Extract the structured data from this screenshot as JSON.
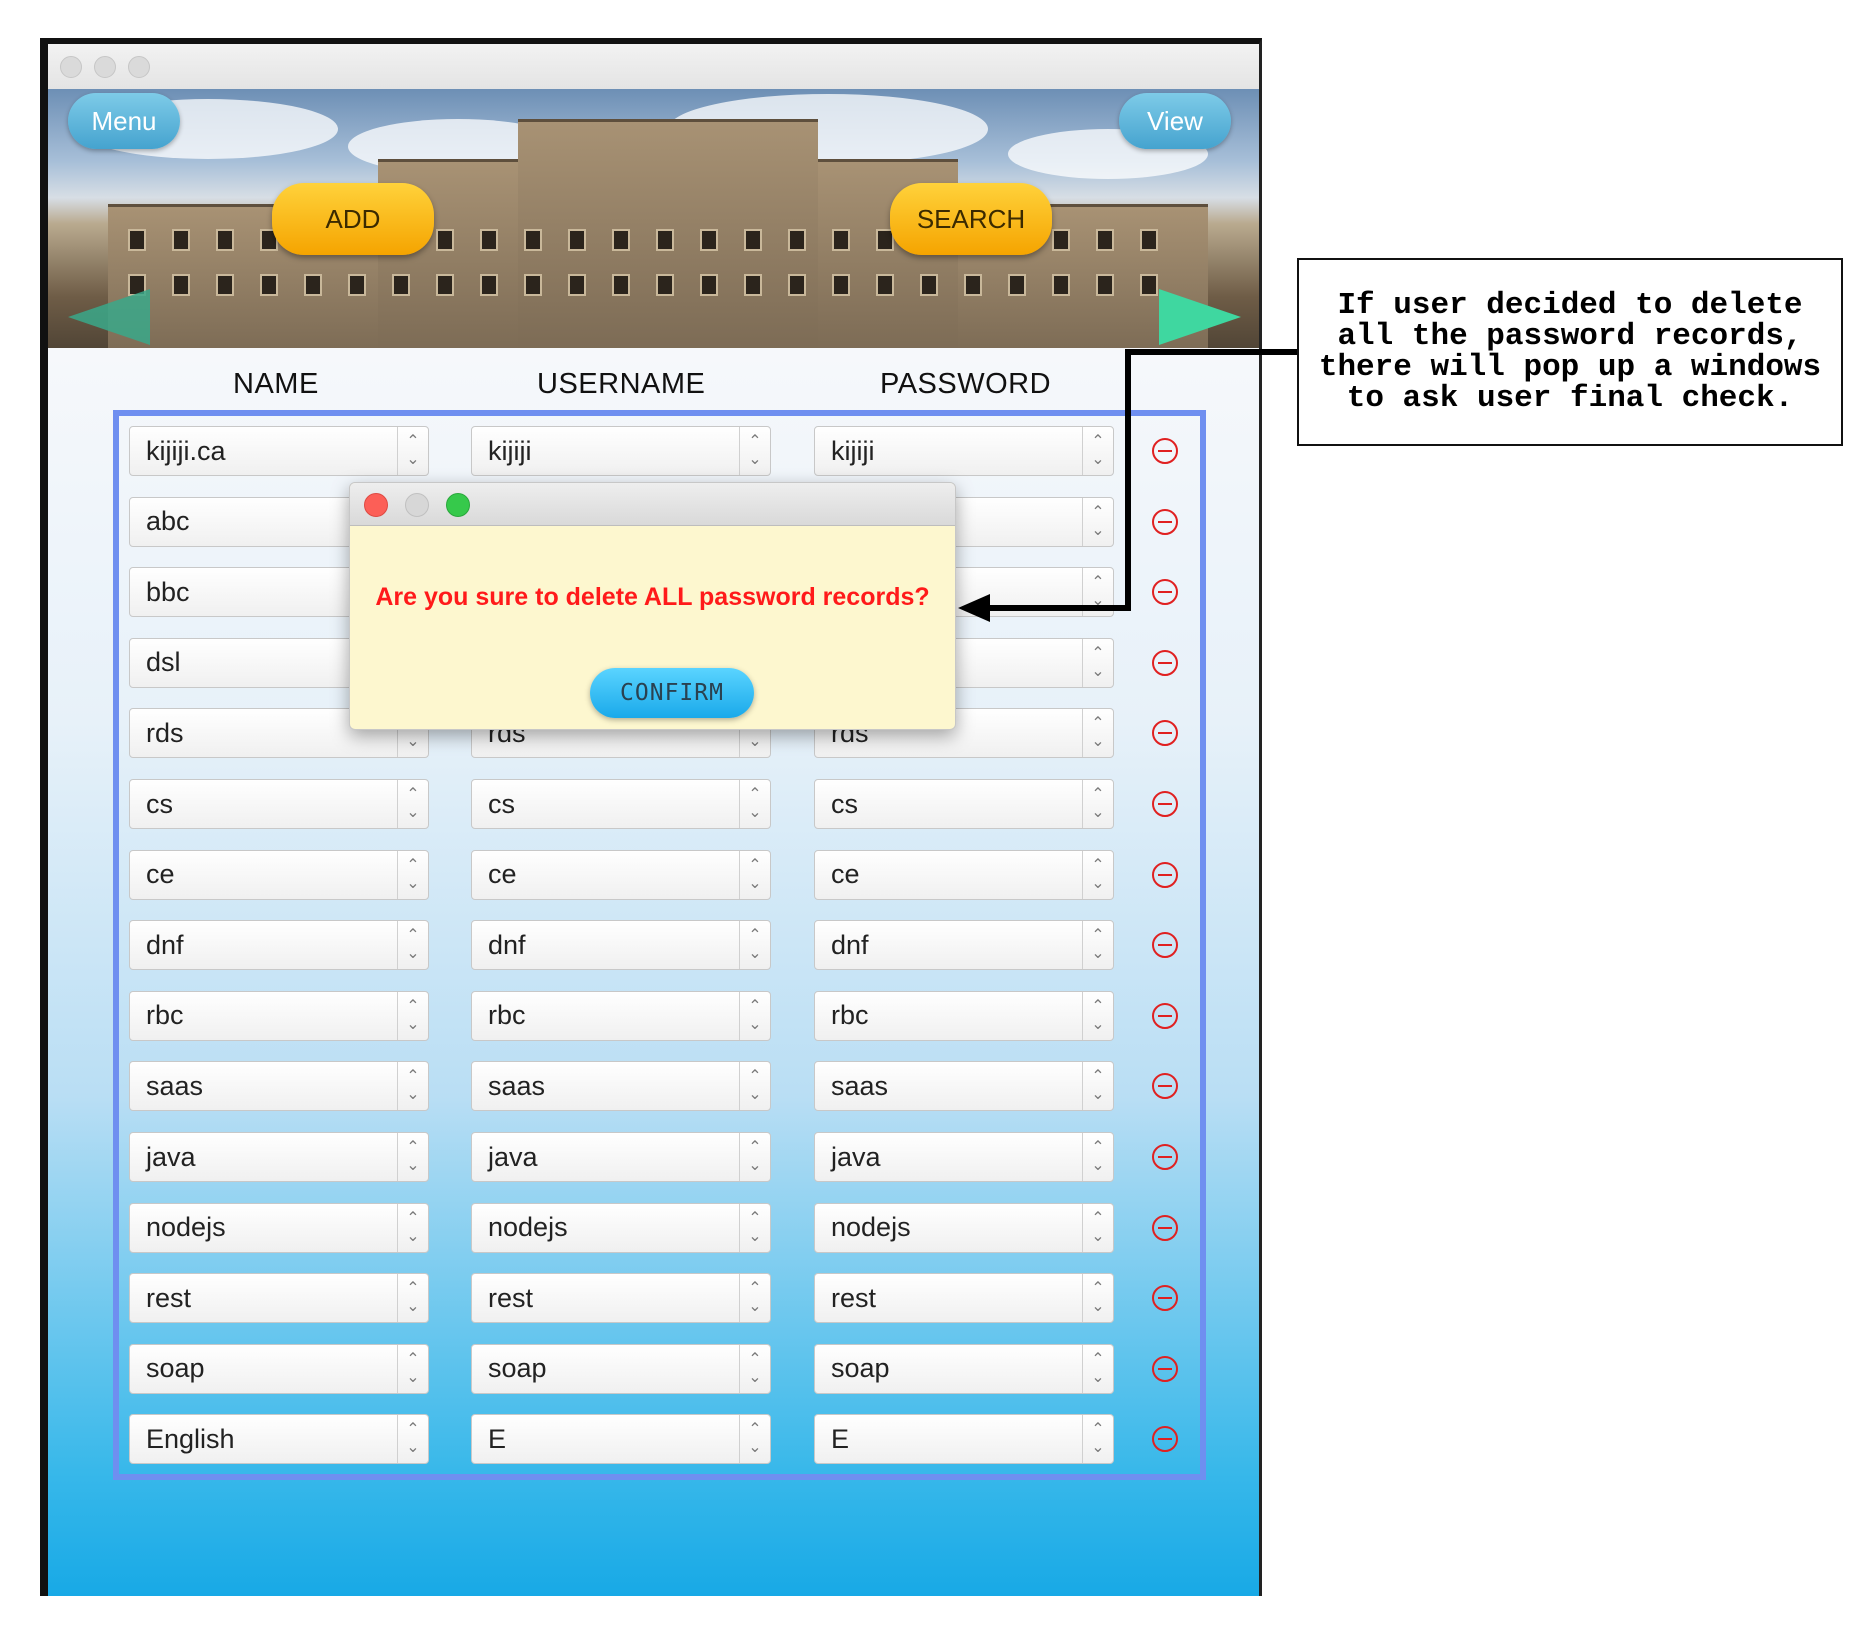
{
  "toolbar": {
    "menu_label": "Menu",
    "view_label": "View",
    "add_label": "ADD",
    "search_label": "SEARCH"
  },
  "columns": {
    "name": "NAME",
    "username": "USERNAME",
    "password": "PASSWORD"
  },
  "records": [
    {
      "name": "kijiji.ca",
      "username": "kijiji",
      "password": "kijiji"
    },
    {
      "name": "abc",
      "username": "",
      "password": ""
    },
    {
      "name": "bbc",
      "username": "",
      "password": ""
    },
    {
      "name": "dsl",
      "username": "",
      "password": ""
    },
    {
      "name": "rds",
      "username": "rds",
      "password": "rds"
    },
    {
      "name": "cs",
      "username": "cs",
      "password": "cs"
    },
    {
      "name": "ce",
      "username": "ce",
      "password": "ce"
    },
    {
      "name": "dnf",
      "username": "dnf",
      "password": "dnf"
    },
    {
      "name": "rbc",
      "username": "rbc",
      "password": "rbc"
    },
    {
      "name": "saas",
      "username": "saas",
      "password": "saas"
    },
    {
      "name": "java",
      "username": "java",
      "password": "java"
    },
    {
      "name": "nodejs",
      "username": "nodejs",
      "password": "nodejs"
    },
    {
      "name": "rest",
      "username": "rest",
      "password": "rest"
    },
    {
      "name": "soap",
      "username": "soap",
      "password": "soap"
    },
    {
      "name": "English",
      "username": "E",
      "password": "E"
    }
  ],
  "dialog": {
    "message": "Are you sure to delete ALL password records?",
    "confirm_label": "CONFIRM"
  },
  "annotation": {
    "text": "If user decided to delete all the password records, there will pop up a windows to ask user final check."
  },
  "colors": {
    "accent": "#6f8ff0",
    "danger": "#e02020",
    "add_button": "#f5a400",
    "confirm_button": "#1aa9ea"
  },
  "icons": {
    "delete_row": "minus-circle-icon",
    "spinner": "chevron-up-down-icon",
    "prev": "arrow-left-icon",
    "next": "arrow-right-icon"
  }
}
